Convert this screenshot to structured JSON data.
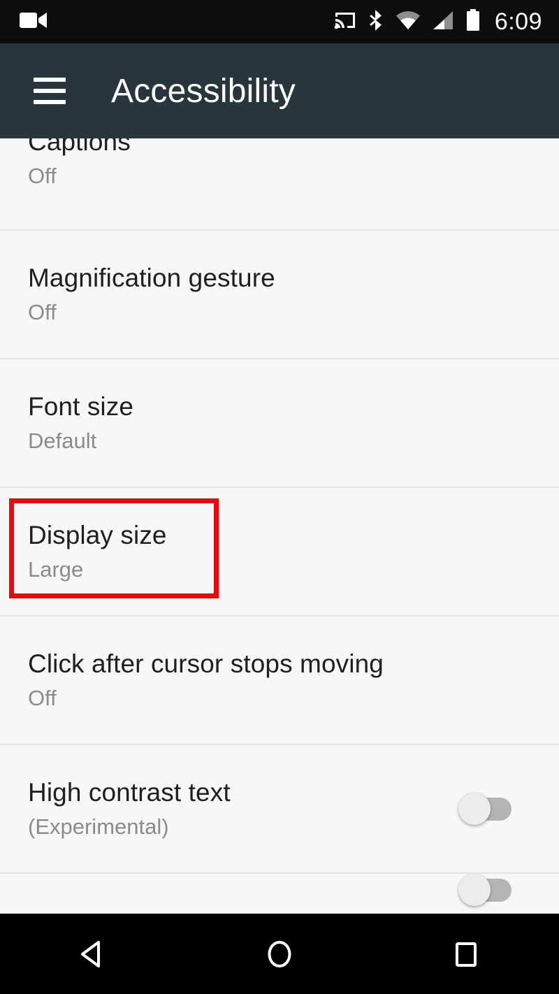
{
  "statusbar": {
    "clock": "6:09",
    "icons": {
      "camcorder": "camcorder-icon",
      "cast": "cast-icon",
      "bluetooth": "bluetooth-icon",
      "wifi": "wifi-icon",
      "signal": "cellular-signal-icon",
      "battery": "battery-full-icon"
    }
  },
  "appbar": {
    "title": "Accessibility",
    "menu_icon": "hamburger-menu-icon"
  },
  "list": {
    "items": [
      {
        "title": "Captions",
        "subtitle": "Off",
        "control": "none"
      },
      {
        "title": "Magnification gesture",
        "subtitle": "Off",
        "control": "none"
      },
      {
        "title": "Font size",
        "subtitle": "Default",
        "control": "none"
      },
      {
        "title": "Display size",
        "subtitle": "Large",
        "control": "none"
      },
      {
        "title": "Click after cursor stops moving",
        "subtitle": "Off",
        "control": "none"
      },
      {
        "title": "High contrast text",
        "subtitle": "(Experimental)",
        "control": "switch",
        "switch_state": "off"
      }
    ]
  },
  "highlight": {
    "color": "#fb0007",
    "target": "Display size"
  },
  "navbar": {
    "back": "back-button",
    "home": "home-button",
    "recents": "recent-apps-button"
  },
  "colors": {
    "status_bar_bg": "#0d0d0d",
    "app_bar_bg": "#27363d",
    "list_bg": "#f7f7f7",
    "divider": "#e4e4e4",
    "title_text": "#1f1f1f",
    "sub_text": "#8b8b8b",
    "nav_bar_bg": "#000000",
    "highlight": "#fb0007"
  }
}
